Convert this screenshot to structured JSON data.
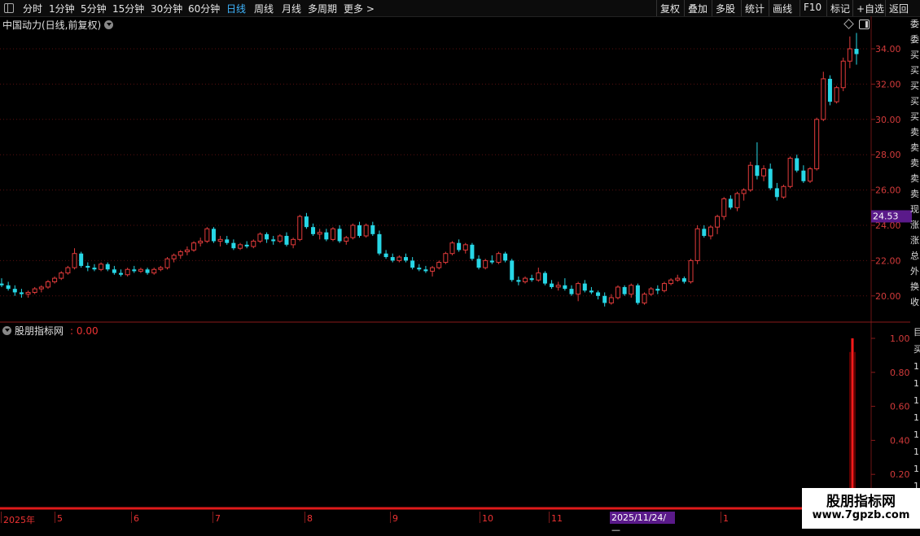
{
  "toolbar": {
    "left_items": [
      "分时",
      "1分钟",
      "5分钟",
      "15分钟",
      "30分钟",
      "60分钟",
      "日线",
      "周线",
      "月线",
      "多周期",
      "更多 >"
    ],
    "active_index": 6,
    "right_items": [
      "复权",
      "叠加",
      "多股",
      "统计",
      "画线",
      "F10",
      "标记",
      "+自选",
      "返回"
    ]
  },
  "main_chart": {
    "title": "中国动力(日线,前复权)",
    "price_badge": "24.53",
    "y_ticks": [
      "34.00",
      "32.00",
      "30.00",
      "28.00",
      "26.00",
      "24.00",
      "22.00",
      "20.00"
    ]
  },
  "sub_chart": {
    "title": "股朋指标网",
    "value": ": 0.00",
    "y_ticks": [
      "1.00",
      "0.80",
      "0.60",
      "0.40",
      "0.20"
    ]
  },
  "date_axis": {
    "labels": [
      "2025年",
      "5",
      "6",
      "7",
      "8",
      "9",
      "10",
      "11",
      "1"
    ],
    "cursor_date": "2025/11/24/—"
  },
  "right_strip": {
    "chars": [
      "委",
      "委",
      "买",
      "买",
      "买",
      "买",
      "买",
      "卖",
      "卖",
      "卖",
      "卖",
      "卖",
      "现",
      "涨",
      "涨",
      "总",
      "外",
      "换",
      "收"
    ],
    "lower_chars": [
      "目",
      "买",
      "1",
      "1",
      "1",
      "1",
      "1",
      "1",
      "1",
      "1"
    ]
  },
  "watermark": {
    "title": "股朋指标网",
    "url": "www.7gpzb.com"
  },
  "colors": {
    "up": "#e23b3b",
    "down": "#27d7e6",
    "grid": "#5a1010",
    "signal": "#ff1a1a"
  },
  "chart_data": {
    "type": "candlestick",
    "ylim": [
      19.0,
      35.0
    ],
    "candles": [
      [
        20.7,
        21.0,
        20.5,
        20.6
      ],
      [
        20.6,
        20.8,
        20.3,
        20.4
      ],
      [
        20.4,
        20.6,
        20.0,
        20.2
      ],
      [
        20.2,
        20.4,
        19.9,
        20.1
      ],
      [
        20.1,
        20.3,
        19.9,
        20.2
      ],
      [
        20.2,
        20.5,
        20.1,
        20.4
      ],
      [
        20.4,
        20.6,
        20.2,
        20.5
      ],
      [
        20.5,
        20.9,
        20.4,
        20.8
      ],
      [
        20.8,
        21.1,
        20.7,
        21.0
      ],
      [
        21.0,
        21.4,
        20.9,
        21.3
      ],
      [
        21.3,
        21.7,
        21.2,
        21.6
      ],
      [
        21.6,
        22.7,
        21.5,
        22.4
      ],
      [
        22.4,
        22.5,
        21.6,
        21.7
      ],
      [
        21.7,
        21.9,
        21.4,
        21.6
      ],
      [
        21.6,
        21.8,
        21.4,
        21.5
      ],
      [
        21.5,
        21.9,
        21.4,
        21.8
      ],
      [
        21.8,
        21.9,
        21.4,
        21.5
      ],
      [
        21.5,
        21.7,
        21.2,
        21.3
      ],
      [
        21.3,
        21.5,
        21.1,
        21.2
      ],
      [
        21.2,
        21.6,
        21.1,
        21.5
      ],
      [
        21.5,
        21.7,
        21.3,
        21.4
      ],
      [
        21.4,
        21.6,
        21.3,
        21.5
      ],
      [
        21.5,
        21.6,
        21.2,
        21.3
      ],
      [
        21.3,
        21.6,
        21.2,
        21.5
      ],
      [
        21.5,
        21.7,
        21.4,
        21.6
      ],
      [
        21.6,
        22.2,
        21.5,
        22.1
      ],
      [
        22.1,
        22.4,
        21.9,
        22.3
      ],
      [
        22.3,
        22.6,
        22.1,
        22.5
      ],
      [
        22.5,
        22.8,
        22.3,
        22.6
      ],
      [
        22.6,
        23.1,
        22.5,
        23.0
      ],
      [
        23.0,
        23.3,
        22.8,
        23.1
      ],
      [
        23.1,
        23.9,
        23.0,
        23.8
      ],
      [
        23.8,
        23.9,
        23.0,
        23.1
      ],
      [
        23.1,
        23.4,
        22.8,
        23.2
      ],
      [
        23.2,
        23.4,
        22.9,
        23.0
      ],
      [
        23.0,
        23.2,
        22.6,
        22.7
      ],
      [
        22.7,
        23.0,
        22.6,
        22.9
      ],
      [
        22.9,
        23.1,
        22.7,
        22.8
      ],
      [
        22.8,
        23.2,
        22.7,
        23.1
      ],
      [
        23.1,
        23.6,
        23.0,
        23.5
      ],
      [
        23.5,
        23.6,
        23.0,
        23.2
      ],
      [
        23.2,
        23.4,
        22.9,
        23.1
      ],
      [
        23.1,
        23.5,
        23.0,
        23.4
      ],
      [
        23.4,
        23.6,
        22.8,
        22.9
      ],
      [
        22.9,
        23.3,
        22.7,
        23.2
      ],
      [
        23.2,
        24.6,
        23.1,
        24.5
      ],
      [
        24.5,
        24.7,
        23.8,
        23.9
      ],
      [
        23.9,
        24.1,
        23.4,
        23.5
      ],
      [
        23.5,
        23.8,
        23.2,
        23.6
      ],
      [
        23.6,
        23.8,
        23.1,
        23.2
      ],
      [
        23.2,
        23.9,
        23.1,
        23.8
      ],
      [
        23.8,
        24.0,
        23.0,
        23.1
      ],
      [
        23.1,
        23.4,
        22.9,
        23.3
      ],
      [
        23.3,
        24.1,
        23.2,
        24.0
      ],
      [
        24.0,
        24.2,
        23.3,
        23.4
      ],
      [
        23.4,
        24.1,
        23.3,
        24.0
      ],
      [
        24.0,
        24.2,
        23.4,
        23.5
      ],
      [
        23.5,
        23.7,
        22.3,
        22.4
      ],
      [
        22.4,
        22.6,
        22.1,
        22.2
      ],
      [
        22.2,
        22.4,
        21.9,
        22.0
      ],
      [
        22.0,
        22.3,
        21.9,
        22.2
      ],
      [
        22.2,
        22.4,
        21.9,
        22.0
      ],
      [
        22.0,
        22.2,
        21.5,
        21.6
      ],
      [
        21.6,
        21.8,
        21.4,
        21.5
      ],
      [
        21.5,
        21.7,
        21.3,
        21.4
      ],
      [
        21.4,
        21.7,
        21.1,
        21.6
      ],
      [
        21.6,
        22.0,
        21.5,
        21.9
      ],
      [
        21.9,
        22.5,
        21.8,
        22.4
      ],
      [
        22.4,
        23.1,
        22.3,
        23.0
      ],
      [
        23.0,
        23.2,
        22.5,
        22.6
      ],
      [
        22.6,
        23.0,
        22.4,
        22.9
      ],
      [
        22.9,
        23.0,
        22.0,
        22.1
      ],
      [
        22.1,
        22.3,
        21.5,
        21.6
      ],
      [
        21.6,
        22.1,
        21.5,
        22.0
      ],
      [
        22.0,
        22.3,
        21.8,
        21.9
      ],
      [
        21.9,
        22.5,
        21.8,
        22.4
      ],
      [
        22.4,
        22.5,
        21.9,
        22.0
      ],
      [
        22.0,
        22.1,
        20.8,
        20.9
      ],
      [
        20.9,
        21.1,
        20.6,
        20.8
      ],
      [
        20.8,
        21.1,
        20.7,
        21.0
      ],
      [
        21.0,
        21.2,
        20.8,
        20.9
      ],
      [
        20.9,
        21.6,
        20.8,
        21.3
      ],
      [
        21.3,
        21.4,
        20.6,
        20.7
      ],
      [
        20.7,
        20.9,
        20.4,
        20.5
      ],
      [
        20.5,
        20.8,
        20.3,
        20.6
      ],
      [
        20.6,
        21.0,
        20.3,
        20.4
      ],
      [
        20.4,
        20.6,
        20.0,
        20.1
      ],
      [
        20.1,
        20.8,
        19.7,
        20.7
      ],
      [
        20.7,
        20.9,
        20.2,
        20.3
      ],
      [
        20.3,
        20.5,
        20.1,
        20.2
      ],
      [
        20.2,
        20.3,
        19.8,
        20.0
      ],
      [
        20.0,
        20.2,
        19.4,
        19.6
      ],
      [
        19.6,
        20.1,
        19.5,
        19.9
      ],
      [
        19.9,
        20.6,
        19.8,
        20.5
      ],
      [
        20.5,
        20.6,
        20.0,
        20.1
      ],
      [
        20.1,
        20.7,
        19.9,
        20.6
      ],
      [
        20.6,
        20.7,
        19.5,
        19.6
      ],
      [
        19.6,
        20.2,
        19.5,
        20.1
      ],
      [
        20.1,
        20.5,
        20.0,
        20.4
      ],
      [
        20.4,
        20.6,
        20.1,
        20.3
      ],
      [
        20.3,
        20.8,
        20.2,
        20.7
      ],
      [
        20.7,
        21.0,
        20.6,
        20.9
      ],
      [
        20.9,
        21.2,
        20.8,
        21.0
      ],
      [
        21.0,
        21.1,
        20.7,
        20.8
      ],
      [
        20.8,
        22.1,
        20.7,
        22.0
      ],
      [
        22.0,
        24.0,
        21.8,
        23.8
      ],
      [
        23.8,
        24.0,
        23.3,
        23.4
      ],
      [
        23.4,
        24.0,
        23.2,
        23.9
      ],
      [
        23.9,
        24.6,
        23.5,
        24.5
      ],
      [
        24.5,
        25.6,
        24.3,
        25.5
      ],
      [
        25.5,
        25.7,
        24.9,
        25.0
      ],
      [
        25.0,
        25.9,
        24.8,
        25.8
      ],
      [
        25.8,
        26.1,
        25.4,
        26.0
      ],
      [
        26.0,
        27.6,
        25.9,
        27.4
      ],
      [
        27.4,
        28.7,
        26.6,
        26.8
      ],
      [
        26.8,
        27.4,
        26.5,
        27.2
      ],
      [
        27.2,
        27.5,
        26.0,
        26.1
      ],
      [
        26.1,
        26.4,
        25.4,
        25.6
      ],
      [
        25.6,
        26.3,
        25.5,
        26.2
      ],
      [
        26.2,
        27.9,
        26.1,
        27.8
      ],
      [
        27.8,
        28.0,
        27.0,
        27.1
      ],
      [
        27.1,
        27.4,
        26.4,
        26.5
      ],
      [
        26.5,
        27.3,
        26.4,
        27.2
      ],
      [
        27.2,
        30.1,
        27.1,
        30.0
      ],
      [
        30.0,
        32.7,
        29.9,
        32.3
      ],
      [
        32.3,
        32.5,
        30.8,
        31.0
      ],
      [
        31.0,
        31.9,
        30.9,
        31.8
      ],
      [
        31.8,
        33.5,
        31.6,
        33.3
      ],
      [
        33.3,
        34.7,
        32.9,
        34.0
      ],
      [
        34.0,
        34.9,
        33.1,
        33.7
      ]
    ],
    "indicator": {
      "name": "股朋指标网",
      "peak": 1.0,
      "ylim": [
        0,
        1.05
      ]
    }
  }
}
